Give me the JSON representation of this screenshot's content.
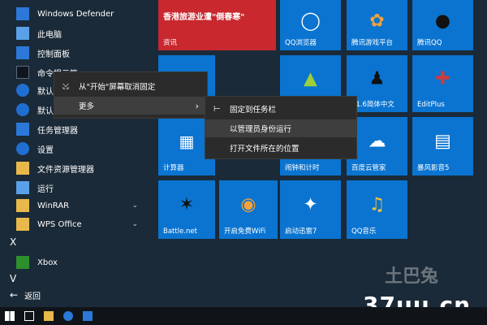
{
  "start_list": {
    "items": [
      {
        "label": "Windows Defender",
        "icon": "shield-icon"
      },
      {
        "label": "此电脑",
        "icon": "computer-icon"
      },
      {
        "label": "控制面板",
        "icon": "control-panel-icon"
      },
      {
        "label": "命令提示符",
        "icon": "cmd-icon"
      },
      {
        "label": "默认",
        "icon": "default-icon"
      },
      {
        "label": "默认",
        "icon": "default-icon"
      },
      {
        "label": "任务管理器",
        "icon": "task-manager-icon"
      },
      {
        "label": "设置",
        "icon": "settings-gear-icon"
      },
      {
        "label": "文件资源管理器",
        "icon": "folder-icon"
      },
      {
        "label": "运行",
        "icon": "run-icon"
      }
    ],
    "groups": [
      {
        "label": "WinRAR"
      },
      {
        "label": "WPS Office"
      }
    ],
    "letter_x": "X",
    "xbox_label": "Xbox",
    "letter_v": "V",
    "back_label": "返回"
  },
  "context_menu": {
    "unpin_label": "从\"开始\"屏幕取消固定",
    "more_label": "更多"
  },
  "submenu": {
    "items": [
      {
        "label": "固定到任务栏"
      },
      {
        "label": "以管理员身份运行"
      },
      {
        "label": "打开文件所在的位置"
      }
    ]
  },
  "tiles": {
    "news_headline": "香港旅游业遭\"倒春寒\"",
    "news_label": "资讯",
    "qq_browser": "QQ浏览器",
    "tencent_games": "腾讯游戏平台",
    "tencent_qq": "腾讯QQ",
    "cs": "S1.6简体中文",
    "editplus": "EditPlus",
    "calculator": "计算器",
    "lol": "闹钟和计时",
    "baidu": "百度云管家",
    "storm": "暴风影音5",
    "battlenet": "Battle.net",
    "wifi": "开启免费WiFi",
    "xunlei": "启动迅雷7",
    "qqmusic": "QQ音乐"
  },
  "watermark": {
    "text": "37uu.cn",
    "cn": "土巴兔"
  },
  "colors": {
    "tile_blue": "#0a74d0",
    "tile_red": "#d23a3a",
    "menu_bg": "#2b2b2b"
  }
}
